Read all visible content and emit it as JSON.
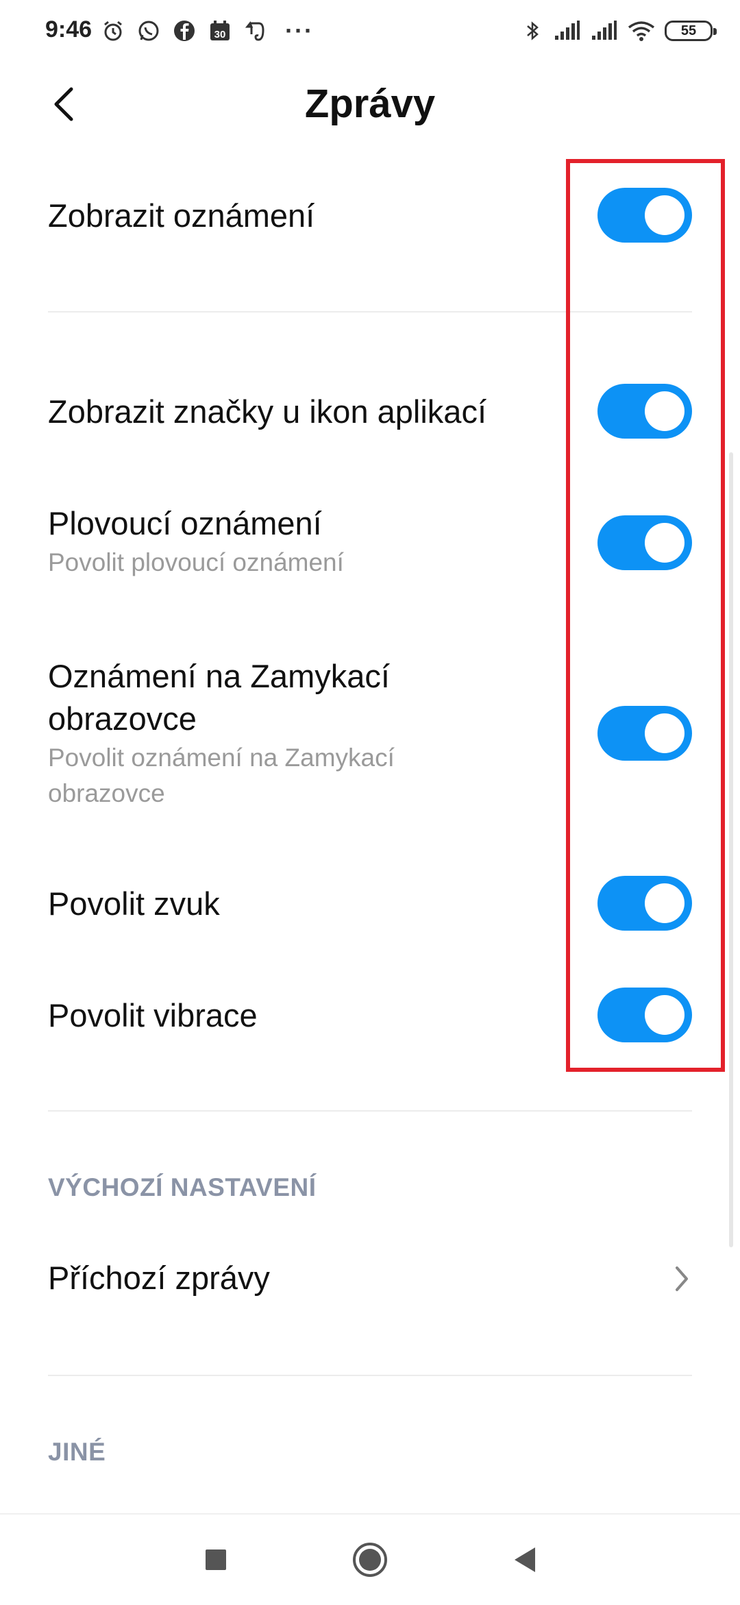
{
  "status_bar": {
    "time": "9:46",
    "left_icons": [
      "alarm-icon",
      "whatsapp-icon",
      "facebook-icon",
      "calendar-icon",
      "evernote-icon"
    ],
    "calendar_day": "30",
    "more": "···",
    "battery": "55"
  },
  "header": {
    "title": "Zprávy"
  },
  "settings": [
    {
      "title": "Zobrazit oznámení",
      "subtitle": "",
      "enabled": true
    },
    {
      "title": "Zobrazit značky u ikon aplikací",
      "subtitle": "",
      "enabled": true
    },
    {
      "title": "Plovoucí oznámení",
      "subtitle": "Povolit plovoucí oznámení",
      "enabled": true
    },
    {
      "title": "Oznámení na Zamykací obrazovce",
      "subtitle": "Povolit oznámení na Zamykací obrazovce",
      "enabled": true
    },
    {
      "title": "Povolit zvuk",
      "subtitle": "",
      "enabled": true
    },
    {
      "title": "Povolit vibrace",
      "subtitle": "",
      "enabled": true
    }
  ],
  "sections": {
    "defaults_header": "VÝCHOZÍ NASTAVENÍ",
    "incoming_messages": "Příchozí zprávy",
    "other_header": "JINÉ"
  },
  "colors": {
    "toggle_on": "#0d92f5",
    "highlight": "#e3212b",
    "section_header": "#8a93a6"
  }
}
